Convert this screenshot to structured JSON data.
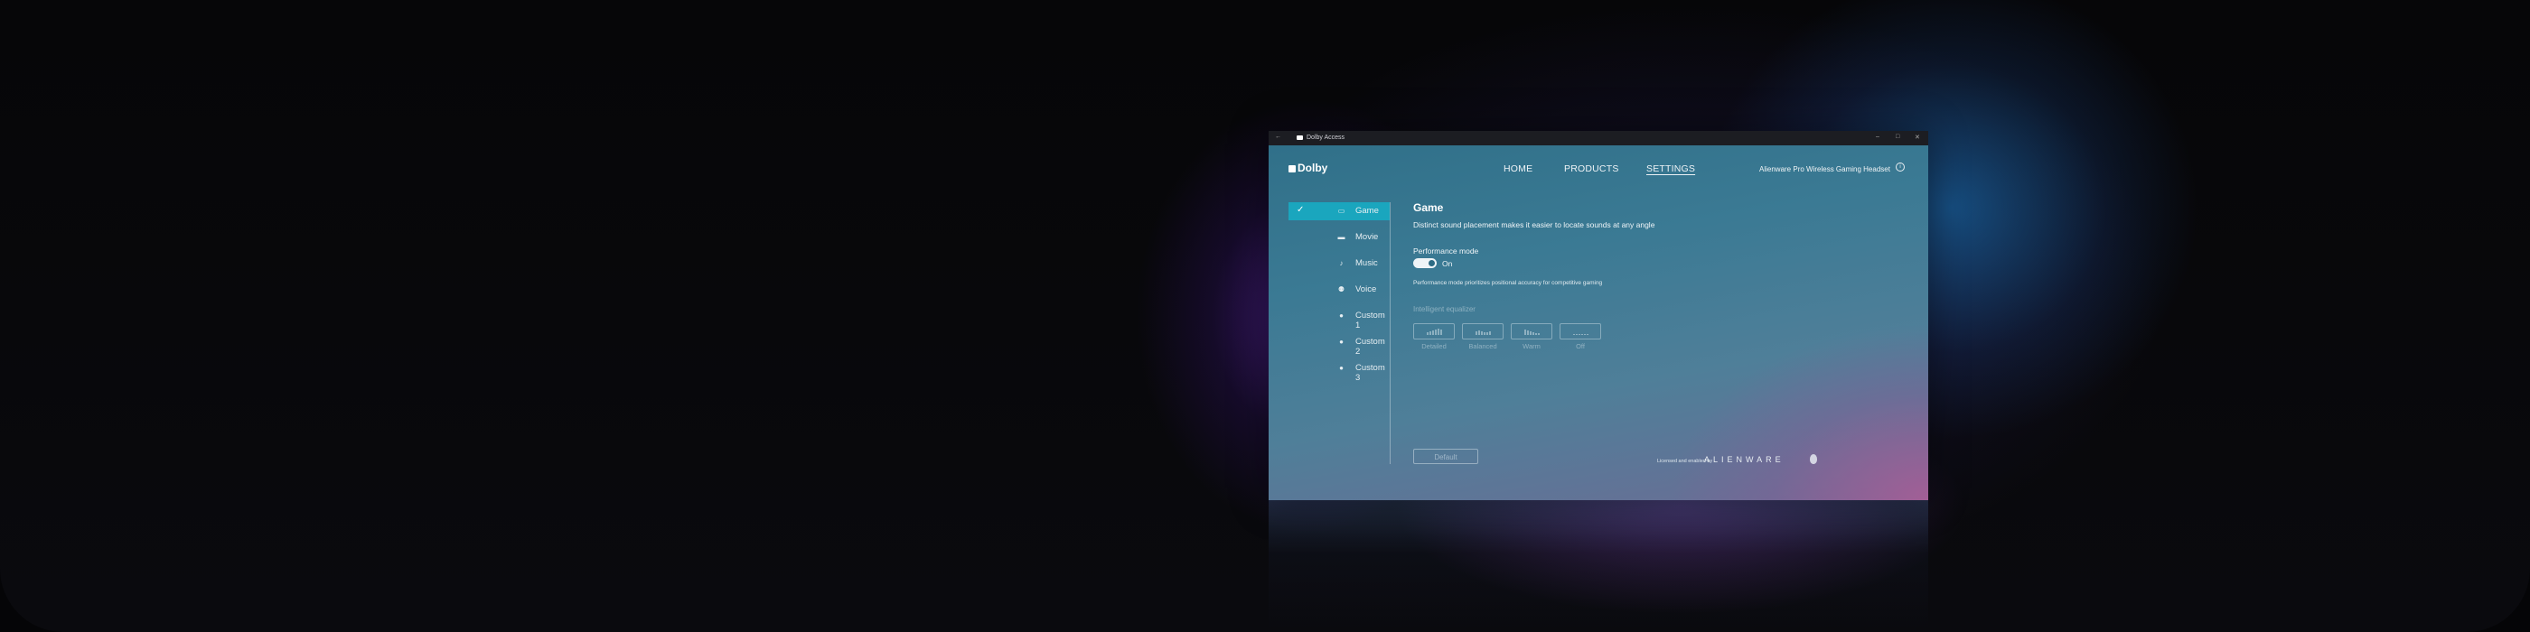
{
  "window": {
    "title": "Dolby Access",
    "back_glyph": "←",
    "controls": [
      "–",
      "□",
      "✕"
    ]
  },
  "nav": {
    "logo_text": "Dolby",
    "links": [
      "HOME",
      "PRODUCTS",
      "SETTINGS"
    ],
    "active_link": "SETTINGS",
    "device_name": "Alienware Pro Wireless Gaming Headset",
    "info_glyph": "i"
  },
  "sidebar": {
    "items": [
      {
        "label": "Game",
        "icon": "gamepad-icon",
        "glyph": "▭",
        "selected": true
      },
      {
        "label": "Movie",
        "icon": "film-icon",
        "glyph": "▬",
        "selected": false
      },
      {
        "label": "Music",
        "icon": "music-note-icon",
        "glyph": "♪",
        "selected": false
      },
      {
        "label": "Voice",
        "icon": "voice-icon",
        "glyph": "⚉",
        "selected": false
      },
      {
        "label": "Custom 1",
        "icon": "person-icon",
        "glyph": "●",
        "selected": false
      },
      {
        "label": "Custom 2",
        "icon": "person-icon",
        "glyph": "●",
        "selected": false
      },
      {
        "label": "Custom 3",
        "icon": "person-icon",
        "glyph": "●",
        "selected": false
      }
    ],
    "check_glyph": "✓"
  },
  "content": {
    "heading": "Game",
    "description": "Distinct sound placement makes it easier to locate sounds at any angle",
    "performance_label": "Performance mode",
    "performance_state": "On",
    "performance_enabled": true,
    "performance_note": "Performance mode prioritizes positional accuracy for competitive gaming",
    "ieq_label": "Intelligent equalizer",
    "eq_presets": [
      {
        "label": "Detailed",
        "bars": [
          3,
          4,
          5,
          6,
          7,
          6
        ]
      },
      {
        "label": "Balanced",
        "bars": [
          4,
          5,
          4,
          3,
          3,
          4
        ]
      },
      {
        "label": "Warm",
        "bars": [
          6,
          5,
          4,
          3,
          2,
          2
        ]
      },
      {
        "label": "Off",
        "bars": [
          1,
          1,
          1,
          1,
          1,
          1
        ]
      }
    ],
    "default_button": "Default"
  },
  "footer": {
    "licensed_text": "Licensed and enabled by",
    "brand": "ALIENWARE"
  },
  "colors": {
    "selected_item": "#1aa6be",
    "titlebar": "#1c1d22",
    "window_top": "#2f6f88",
    "window_bottom": "#6c6c95"
  }
}
